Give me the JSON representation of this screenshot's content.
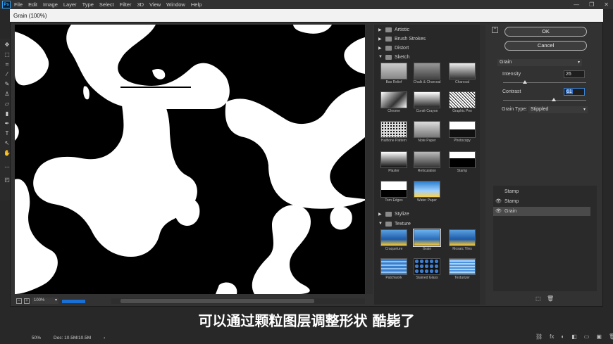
{
  "app": {
    "logo": "Ps",
    "menu": [
      "File",
      "Edit",
      "Image",
      "Layer",
      "Type",
      "Select",
      "Filter",
      "3D",
      "View",
      "Window",
      "Help"
    ],
    "window_controls": [
      "—",
      "❐",
      "✕"
    ]
  },
  "dialog": {
    "title": "Grain (100%)"
  },
  "preview": {
    "zoom": "100%"
  },
  "gallery": {
    "folders_top": [
      {
        "label": "Artistic",
        "expanded": false
      },
      {
        "label": "Brush Strokes",
        "expanded": false
      },
      {
        "label": "Distort",
        "expanded": false
      },
      {
        "label": "Sketch",
        "expanded": true
      }
    ],
    "sketch_filters": [
      "Bas Relief",
      "Chalk & Charcoal",
      "Charcoal",
      "Chrome",
      "Conté Crayon",
      "Graphic Pen",
      "Halftone Pattern",
      "Note Paper",
      "Photocopy",
      "Plaster",
      "Reticulation",
      "Stamp",
      "Torn Edges",
      "Water Paper"
    ],
    "stylize": {
      "label": "Stylize",
      "expanded": false
    },
    "texture": {
      "label": "Texture",
      "expanded": true
    },
    "texture_filters": [
      "Craquelure",
      "Grain",
      "Mosaic Tiles",
      "Patchwork",
      "Stained Glass",
      "Texturizer"
    ],
    "selected": "Grain"
  },
  "buttons": {
    "ok": "OK",
    "cancel": "Cancel"
  },
  "filter_select": {
    "value": "Grain"
  },
  "params": {
    "intensity": {
      "label": "Intensity",
      "value": "26",
      "fraction": 0.26
    },
    "contrast": {
      "label": "Contrast",
      "value": "61",
      "fraction": 0.61
    },
    "grain_type": {
      "label": "Grain Type:",
      "value": "Stippled"
    }
  },
  "layers": [
    {
      "name": "Stamp",
      "visible": false,
      "selected": false
    },
    {
      "name": "Stamp",
      "visible": true,
      "selected": false
    },
    {
      "name": "Grain",
      "visible": true,
      "selected": true
    }
  ],
  "layer_tools": {
    "new": "⬚",
    "delete": "🗑"
  },
  "subtitle": "可以通过颗粒图层调整形状 酷毙了",
  "status": {
    "zoom": "50%",
    "doc": "Doc: 10.5M/10.5M",
    "arrow": "›"
  },
  "bottom_icons": [
    "⛓",
    "fx",
    "◐",
    "◧",
    "▭",
    "▣",
    "🗑"
  ],
  "colors": {
    "accent": "#2f6fcc",
    "progress": "#1a6fd4"
  }
}
